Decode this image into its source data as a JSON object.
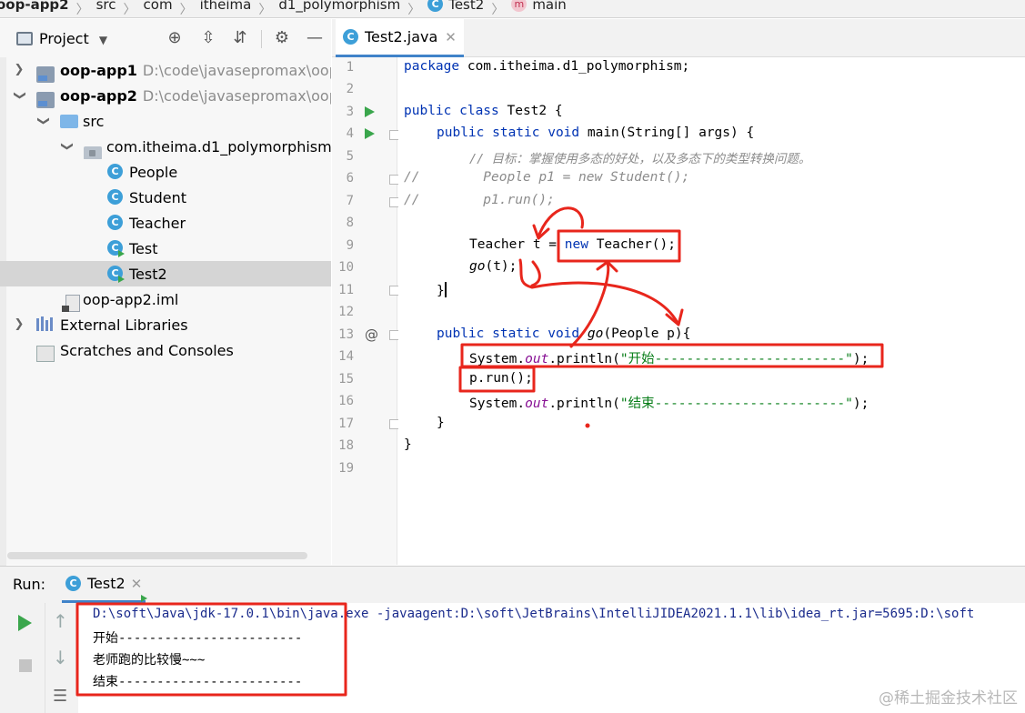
{
  "breadcrumb": [
    "oop-app2",
    "src",
    "com",
    "itheima",
    "d1_polymorphism",
    "Test2",
    "main"
  ],
  "project": {
    "title": "Project",
    "tree": [
      {
        "label": "oop-app1",
        "path": "D:\\code\\javasepromax\\oop-ap",
        "arrow": ">"
      },
      {
        "label": "oop-app2",
        "path": "D:\\code\\javasepromax\\oop-ap",
        "arrow": "v"
      },
      {
        "label": "src",
        "arrow": "v"
      },
      {
        "label": "com.itheima.d1_polymorphism",
        "arrow": "v"
      },
      {
        "label": "People"
      },
      {
        "label": "Student"
      },
      {
        "label": "Teacher"
      },
      {
        "label": "Test"
      },
      {
        "label": "Test2"
      },
      {
        "label": "oop-app2.iml"
      },
      {
        "label": "External Libraries",
        "arrow": ">"
      },
      {
        "label": "Scratches and Consoles"
      }
    ]
  },
  "editor": {
    "tab": "Test2.java",
    "line_numbers": [
      "1",
      "2",
      "3",
      "4",
      "5",
      "6",
      "7",
      "8",
      "9",
      "10",
      "11",
      "12",
      "13",
      "14",
      "15",
      "16",
      "17",
      "18",
      "19"
    ],
    "code": {
      "l1_kw": "package",
      "l1_rest": " com.itheima.d1_polymorphism;",
      "l3_kw": "public class",
      "l3_rest": " Test2 {",
      "l4_kw": "public static void",
      "l4_rest": " main(String[] args) {",
      "l5": "// 目标：掌握使用多态的好处，以及多态下的类型转换问题。",
      "l6": "//        People p1 = new Student();",
      "l7": "//        p1.run();",
      "l9_a": "Teacher t = ",
      "l9_kw": "new",
      "l9_b": " Teacher();",
      "l10_it": "go",
      "l10_rest": "(t);",
      "l11": "}",
      "l13_kw": "public static void",
      "l13_it": " go",
      "l13_rest": "(People p){",
      "l14_a": "System.",
      "l14_fld": "out",
      "l14_b": ".println(",
      "l14_str": "\"开始------------------------\"",
      "l14_c": ");",
      "l15": "p.run();",
      "l16_a": "System.",
      "l16_fld": "out",
      "l16_b": ".println(",
      "l16_str": "\"结束------------------------\"",
      "l16_c": ");",
      "l17": "}",
      "l18": "}"
    }
  },
  "run": {
    "label": "Run:",
    "tab": "Test2",
    "console": [
      "D:\\soft\\Java\\jdk-17.0.1\\bin\\java.exe -javaagent:D:\\soft\\JetBrains\\IntelliJIDEA2021.1.1\\lib\\idea_rt.jar=5695:D:\\soft",
      "开始------------------------",
      "老师跑的比较慢~~~",
      "结束------------------------"
    ]
  },
  "watermark": "@稀土掘金技术社区",
  "colors": {
    "annotation_red": "#e8261c",
    "selection": "#d5d5d5",
    "tab_underline": "#4083c9"
  }
}
